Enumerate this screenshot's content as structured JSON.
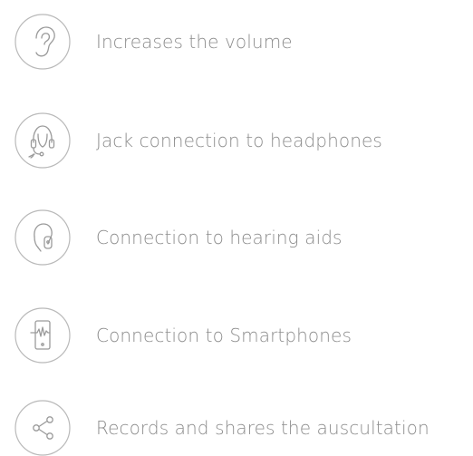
{
  "features": [
    {
      "icon": "ear-icon",
      "label": "Increases the volume"
    },
    {
      "icon": "headset-icon",
      "label": "Jack connection to headphones"
    },
    {
      "icon": "hearing-aid-icon",
      "label": "Connection to hearing aids"
    },
    {
      "icon": "smartphone-icon",
      "label": "Connection to Smartphones"
    },
    {
      "icon": "share-icon",
      "label": "Records and shares the auscultation"
    }
  ],
  "colors": {
    "text": "#8c8c8c",
    "icon_stroke": "#9a9a9a",
    "ring": "#b9b9b9"
  }
}
